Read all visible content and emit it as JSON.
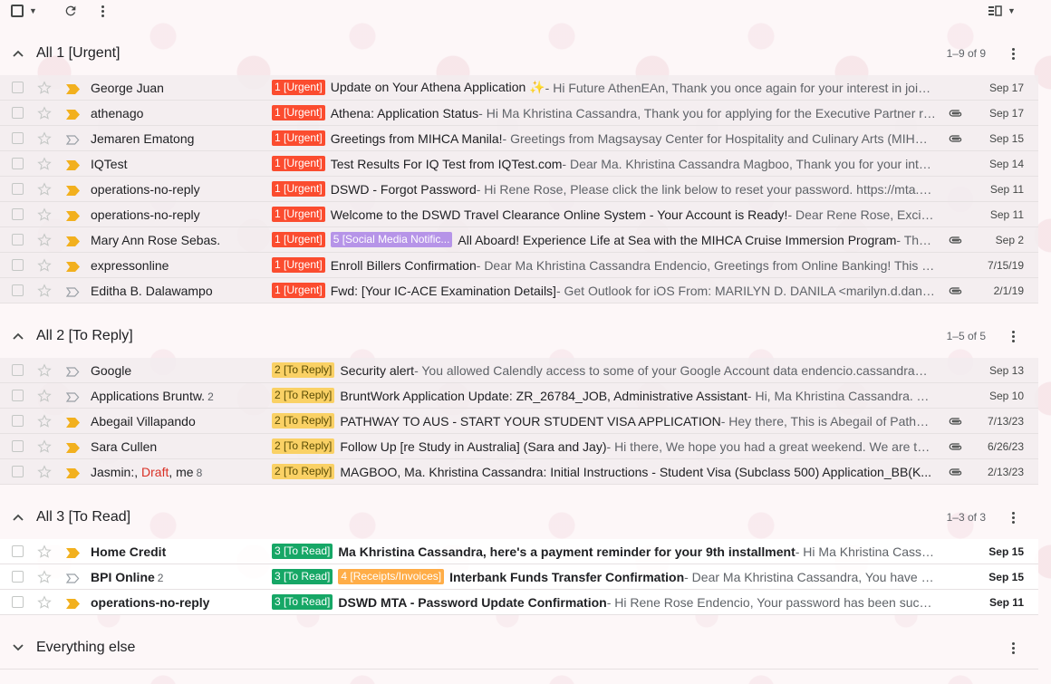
{
  "toolbar": {
    "select_icon": "checkbox-icon",
    "caret_icon": "caret-down-icon",
    "refresh_icon": "refresh-icon",
    "more_icon": "more-vert-icon",
    "split_icon": "split-pane-icon"
  },
  "sections": [
    {
      "title": "All 1 [Urgent]",
      "count": "1–9 of 9",
      "rows": [
        {
          "sender": "George Juan",
          "labels": [
            {
              "text": "1 [Urgent]",
              "kind": "urgent"
            }
          ],
          "subject": "Update on Your Athena Application ✨",
          "snippet": " - Hi Future AthenEAn, Thank you once again for your interest in joining our team",
          "date": "Sep 17",
          "important": true,
          "attachment": false,
          "unread": false
        },
        {
          "sender": "athenago",
          "labels": [
            {
              "text": "1 [Urgent]",
              "kind": "urgent"
            }
          ],
          "subject": "Athena: Application Status",
          "snippet": " - Hi Ma Khristina Cassandra, Thank you for applying for the Executive Partner role",
          "date": "Sep 17",
          "important": true,
          "attachment": true,
          "unread": false
        },
        {
          "sender": "Jemaren Ematong",
          "labels": [
            {
              "text": "1 [Urgent]",
              "kind": "urgent"
            }
          ],
          "subject": "Greetings from MIHCA Manila!",
          "snippet": " - Greetings from Magsaysay Center for Hospitality and Culinary Arts (MIHCA)",
          "date": "Sep 15",
          "important": false,
          "attachment": true,
          "unread": false
        },
        {
          "sender": "IQTest",
          "labels": [
            {
              "text": "1 [Urgent]",
              "kind": "urgent"
            }
          ],
          "subject": "Test Results For IQ Test from IQTest.com",
          "snippet": " - Dear Ma. Khristina Cassandra Magboo, Thank you for your interest in our test",
          "date": "Sep 14",
          "important": true,
          "attachment": false,
          "unread": false
        },
        {
          "sender": "operations-no-reply",
          "labels": [
            {
              "text": "1 [Urgent]",
              "kind": "urgent"
            }
          ],
          "subject": "DSWD - Forgot Password",
          "snippet": " - Hi Rene Rose, Please click the link below to reset your password. https://mta.dswd.gov.ph",
          "date": "Sep 11",
          "important": true,
          "attachment": false,
          "unread": false
        },
        {
          "sender": "operations-no-reply",
          "labels": [
            {
              "text": "1 [Urgent]",
              "kind": "urgent"
            }
          ],
          "subject": "Welcome to the DSWD Travel Clearance Online System - Your Account is Ready!",
          "snippet": " - Dear Rene Rose, Exciting news",
          "date": "Sep 11",
          "important": true,
          "attachment": false,
          "unread": false
        },
        {
          "sender": "Mary Ann Rose Sebas.",
          "labels": [
            {
              "text": "1 [Urgent]",
              "kind": "urgent"
            },
            {
              "text": "5 [Social Media Notific...",
              "kind": "social"
            }
          ],
          "subject": "All Aboard! Experience Life at Sea with the MIHCA Cruise Immersion Program",
          "snippet": " - The MIHCA Cruise",
          "date": "Sep 2",
          "important": true,
          "attachment": true,
          "unread": false
        },
        {
          "sender": "expressonline",
          "labels": [
            {
              "text": "1 [Urgent]",
              "kind": "urgent"
            }
          ],
          "subject": "Enroll Billers Confirmation",
          "snippet": " - Dear Ma Khristina Cassandra Endencio, Greetings from Online Banking! This is to confirm",
          "date": "7/15/19",
          "important": true,
          "attachment": false,
          "unread": false
        },
        {
          "sender": "Editha B. Dalawampo",
          "labels": [
            {
              "text": "1 [Urgent]",
              "kind": "urgent"
            }
          ],
          "subject": "Fwd: [Your IC-ACE Examination Details]",
          "snippet": " - Get Outlook for iOS From: MARILYN D. DANILA <marilyn.d.danila@example>",
          "date": "2/1/19",
          "important": false,
          "attachment": true,
          "unread": false
        }
      ]
    },
    {
      "title": "All 2 [To Reply]",
      "count": "1–5 of 5",
      "rows": [
        {
          "sender": "Google",
          "labels": [
            {
              "text": "2 [To Reply]",
              "kind": "reply"
            }
          ],
          "subject": "Security alert",
          "snippet": " - You allowed Calendly access to some of your Google Account data endencio.cassandra@gmail.com",
          "date": "Sep 13",
          "important": false,
          "attachment": false,
          "unread": false
        },
        {
          "sender": "Applications Bruntw.",
          "count": "2",
          "labels": [
            {
              "text": "2 [To Reply]",
              "kind": "reply"
            }
          ],
          "subject": "BruntWork Application Update: ZR_26784_JOB, Administrative Assistant",
          "snippet": " - Hi, Ma Khristina Cassandra. Thank you",
          "date": "Sep 10",
          "important": false,
          "attachment": false,
          "unread": false
        },
        {
          "sender": "Abegail Villapando",
          "labels": [
            {
              "text": "2 [To Reply]",
              "kind": "reply"
            }
          ],
          "subject": "PATHWAY TO AUS - START YOUR STUDENT VISA APPLICATION",
          "snippet": " - Hey there, This is Abegail of Pathway to Australia",
          "date": "7/13/23",
          "important": true,
          "attachment": true,
          "unread": false
        },
        {
          "sender": "Sara Cullen",
          "labels": [
            {
              "text": "2 [To Reply]",
              "kind": "reply"
            }
          ],
          "subject": "Follow Up [re Study in Australia] (Sara and Jay)",
          "snippet": " - Hi there, We hope you had a great weekend. We are touching base",
          "date": "6/26/23",
          "important": true,
          "attachment": true,
          "unread": false
        },
        {
          "sender_parts": [
            "Jasmin:, ",
            "Draft",
            ", me"
          ],
          "count": "8",
          "labels": [
            {
              "text": "2 [To Reply]",
              "kind": "reply"
            }
          ],
          "subject": "MAGBOO, Ma. Khristina Cassandra: Initial Instructions - Student Visa (Subclass 500) Application_BB(K...",
          "snippet": "",
          "date": "2/13/23",
          "important": true,
          "attachment": true,
          "unread": false
        }
      ]
    },
    {
      "title": "All 3 [To Read]",
      "count": "1–3 of 3",
      "rows": [
        {
          "sender": "Home Credit",
          "labels": [
            {
              "text": "3 [To Read]",
              "kind": "read-l"
            }
          ],
          "subject": "Ma Khristina Cassandra, here's a payment reminder for your 9th installment",
          "snippet": " - Hi Ma Khristina Cassandra, your payment is due",
          "date": "Sep 15",
          "important": true,
          "attachment": false,
          "unread": true
        },
        {
          "sender": "BPI Online",
          "count": "2",
          "labels": [
            {
              "text": "3 [To Read]",
              "kind": "read-l"
            },
            {
              "text": "4 [Receipts/Invoices]",
              "kind": "receipts"
            }
          ],
          "subject": "Interbank Funds Transfer Confirmation",
          "snippet": " - Dear Ma Khristina Cassandra, You have successfully transferred",
          "date": "Sep 15",
          "important": false,
          "attachment": false,
          "unread": true
        },
        {
          "sender": "operations-no-reply",
          "labels": [
            {
              "text": "3 [To Read]",
              "kind": "read-l"
            }
          ],
          "subject": "DSWD MTA - Password Update Confirmation",
          "snippet": " - Hi Rene Rose Endencio, Your password has been successfully updated",
          "date": "Sep 11",
          "important": true,
          "attachment": false,
          "unread": true
        }
      ]
    },
    {
      "title": "Everything else",
      "count": "",
      "rows": []
    }
  ],
  "colors": {
    "urgent": "#fb4c2f",
    "reply": "#fad165",
    "read": "#16a766",
    "social": "#b694e8",
    "receipts": "#ffad47",
    "important": "#f2b01e"
  }
}
